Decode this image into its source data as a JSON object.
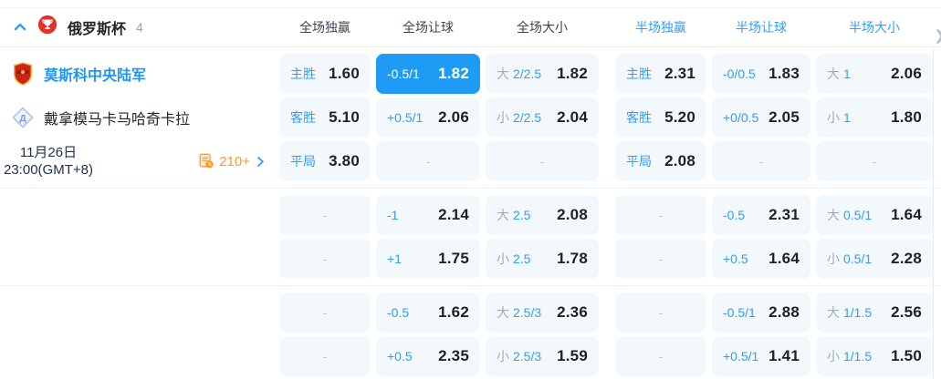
{
  "colors": {
    "accent_blue": "#1e9bf5",
    "label_blue": "#2f9ef6",
    "team_blue": "#1e97f2",
    "orange": "#ff992e",
    "cell_bg": "#f3f8fd"
  },
  "header": {
    "league": "俄罗斯杯",
    "count": "4",
    "columns": [
      "全场独赢",
      "全场让球",
      "全场大小",
      "半场独赢",
      "半场让球",
      "半场大小"
    ]
  },
  "match": {
    "home": "莫斯科中央陆军",
    "away": "戴拿模马卡马哈奇卡拉",
    "date_line1": "11月26日",
    "date_line2": "23:00(GMT+8)",
    "markets_count": "210+"
  },
  "odds": {
    "rows": [
      {
        "c": [
          {
            "label": "主胜",
            "value": "1.60"
          },
          {
            "label": "-0.5/1",
            "value": "1.82"
          },
          {
            "prefix": "大",
            "label": "2/2.5",
            "value": "1.82"
          },
          {
            "label": "主胜",
            "value": "2.31"
          },
          {
            "label": "-0/0.5",
            "value": "1.83"
          },
          {
            "prefix": "大",
            "label": "1",
            "value": "2.06"
          }
        ]
      },
      {
        "c": [
          {
            "label": "客胜",
            "value": "5.10"
          },
          {
            "label": "+0.5/1",
            "value": "2.06"
          },
          {
            "prefix": "小",
            "label": "2/2.5",
            "value": "2.04"
          },
          {
            "label": "客胜",
            "value": "5.20"
          },
          {
            "label": "+0/0.5",
            "value": "2.05"
          },
          {
            "prefix": "小",
            "label": "1",
            "value": "1.80"
          }
        ]
      },
      {
        "c": [
          {
            "label": "平局",
            "value": "3.80"
          },
          {
            "dash": "-"
          },
          {
            "dash": "-"
          },
          {
            "label": "平局",
            "value": "2.08"
          },
          {
            "dash": "-"
          },
          {
            "dash": "-"
          }
        ]
      },
      {
        "c": [
          {
            "dash": "-"
          },
          {
            "label": "-1",
            "value": "2.14"
          },
          {
            "prefix": "大",
            "label": "2.5",
            "value": "2.08"
          },
          {
            "dash": "-"
          },
          {
            "label": "-0.5",
            "value": "2.31"
          },
          {
            "prefix": "大",
            "label": "0.5/1",
            "value": "1.64"
          }
        ]
      },
      {
        "c": [
          {
            "dash": "-"
          },
          {
            "label": "+1",
            "value": "1.75"
          },
          {
            "prefix": "小",
            "label": "2.5",
            "value": "1.78"
          },
          {
            "dash": "-"
          },
          {
            "label": "+0.5",
            "value": "1.64"
          },
          {
            "prefix": "小",
            "label": "0.5/1",
            "value": "2.28"
          }
        ]
      },
      {
        "c": [
          {
            "dash": "-"
          },
          {
            "label": "-0.5",
            "value": "1.62"
          },
          {
            "prefix": "大",
            "label": "2.5/3",
            "value": "2.36"
          },
          {
            "dash": "-"
          },
          {
            "label": "-0.5/1",
            "value": "2.88"
          },
          {
            "prefix": "大",
            "label": "1/1.5",
            "value": "2.56"
          }
        ]
      },
      {
        "c": [
          {
            "dash": "-"
          },
          {
            "label": "+0.5",
            "value": "2.35"
          },
          {
            "prefix": "小",
            "label": "2.5/3",
            "value": "1.59"
          },
          {
            "dash": "-"
          },
          {
            "label": "+0.5/1",
            "value": "1.41"
          },
          {
            "prefix": "小",
            "label": "1/1.5",
            "value": "1.50"
          }
        ]
      }
    ]
  }
}
